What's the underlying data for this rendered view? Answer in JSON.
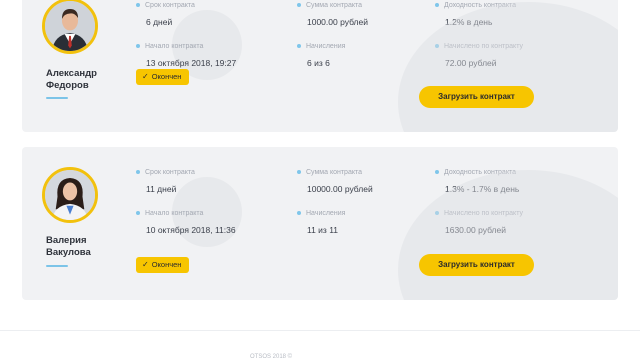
{
  "labels": {
    "term": "Срок контракта",
    "amount": "Сумма контракта",
    "yield": "Доходность контракта",
    "start": "Начало контракта",
    "accruals": "Начисления",
    "income": "Начислено по контракту"
  },
  "contracts": [
    {
      "name_line1": "Александр",
      "name_line2": "Федоров",
      "term": "6 дней",
      "amount": "1000.00 рублей",
      "yield": "1.2% в день",
      "start": "13 октября 2018, 19:27",
      "accruals": "6 из 6",
      "income": "72.00 рублей",
      "status": "Окончен",
      "button": "Загрузить контракт"
    },
    {
      "name_line1": "Валерия",
      "name_line2": "Вакулова",
      "term": "11 дней",
      "amount": "10000.00 рублей",
      "yield": "1.3% - 1.7% в день",
      "start": "10 октября 2018, 11:36",
      "accruals": "11 из 11",
      "income": "1630.00 рублей",
      "status": "Окончен",
      "button": "Загрузить контракт"
    }
  ],
  "footer": {
    "text": "OTSOS 2018 ©"
  },
  "colors": {
    "accent": "#f7c500",
    "dot": "#7fc6ea",
    "card_bg": "#f1f2f4"
  }
}
